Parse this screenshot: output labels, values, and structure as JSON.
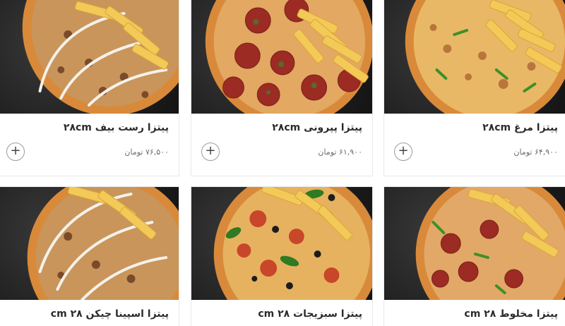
{
  "products": [
    {
      "title": "پیتزا مرغ ۲۸cm",
      "price": "۶۴,۹۰۰ تومان",
      "topping": "chicken"
    },
    {
      "title": "پیتزا پپرونی ۲۸cm",
      "price": "۶۱,۹۰۰ تومان",
      "topping": "pepperoni"
    },
    {
      "title": "پیتزا رست بیف ۲۸cm",
      "price": "۷۶,۵۰۰ تومان",
      "topping": "roastbeef"
    },
    {
      "title": "پیتزا مخلوط ۲۸ cm",
      "price": "",
      "topping": "mixed"
    },
    {
      "title": "پیتزا سبزیجات ۲۸ cm",
      "price": "",
      "topping": "veggie"
    },
    {
      "title": "پیتزا اسپینا چیکن ۲۸ cm",
      "price": "",
      "topping": "spinachchicken"
    }
  ],
  "add_symbol": "+",
  "colors": {
    "background": "#1d1d1d",
    "crust": "#d88a3a",
    "cheese": "#e9b866",
    "sauce": "#c8462a",
    "pepperoni": "#9c2b24",
    "fries": "#f3c957",
    "sauce_drizzle": "#f4f1ea",
    "olive": "#1c1c1c",
    "pepper": "#3e8f2a",
    "card_border": "#e8e8e8",
    "title_text": "#2b2b2b",
    "price_text": "#6d6d6d"
  }
}
